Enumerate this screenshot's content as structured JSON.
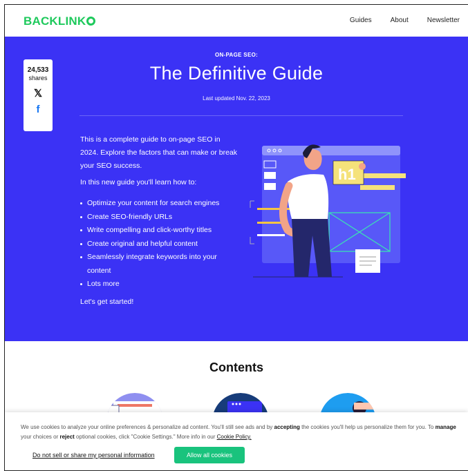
{
  "header": {
    "logo": "BACKLINK",
    "nav": [
      "Guides",
      "About",
      "Newsletter"
    ]
  },
  "share": {
    "count": "24,533",
    "label": "shares",
    "icons": [
      "x-icon",
      "facebook-icon"
    ]
  },
  "hero": {
    "kicker": "ON-PAGE SEO:",
    "title": "The Definitive Guide",
    "updated": "Last updated Nov. 22, 2023",
    "intro": "This is a complete guide to on-page SEO in 2024. Explore the factors that can make or break your SEO success.",
    "sub": "In this new guide you'll learn how to:",
    "bullets": [
      "Optimize your content for search engines",
      "Create SEO-friendly URLs",
      "Write compelling and click-worthy titles",
      "Create original and helpful content",
      "Seamlessly integrate keywords into your content",
      "Lots more"
    ],
    "started": "Let's get started!",
    "illustration_tag": "h1"
  },
  "contents": {
    "heading": "Contents"
  },
  "cookie": {
    "part1": "We use cookies to analyze your online preferences & personalize ad content. You'll still see ads and by ",
    "accepting": "accepting",
    "part2": " the cookies you'll help us personalize them for you. To ",
    "manage": "manage",
    "part3": " your choices or ",
    "reject": "reject",
    "part4": " optional cookies, click \"Cookie Settings.\" More info in our ",
    "policy": "Cookie Policy.",
    "dns": "Do not sell or share my personal information",
    "allow": "Allow all cookies"
  },
  "colors": {
    "brand_green": "#1ec95c",
    "hero_blue": "#3b32f5",
    "accent_yellow": "#f5e27a",
    "cookie_button": "#19c37d"
  }
}
